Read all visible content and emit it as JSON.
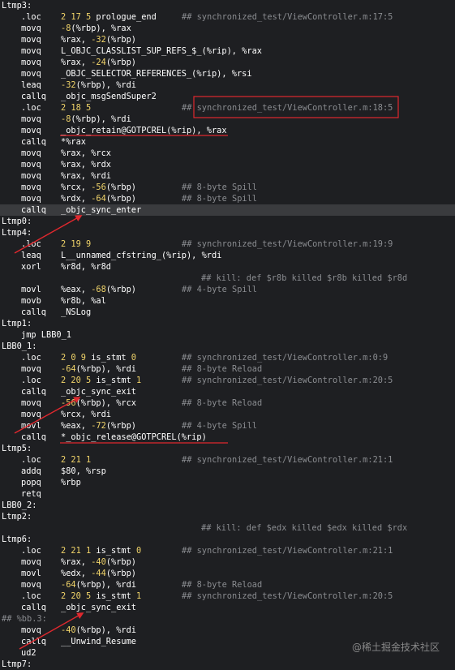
{
  "lines": [
    {
      "label": "Ltmp3:"
    },
    {
      "op": ".loc",
      "args": [
        {
          "t": "2 17 5",
          "n": true
        },
        {
          "t": " prologue_end"
        }
      ],
      "comment": "## synchronized_test/ViewController.m:17:5"
    },
    {
      "op": "movq",
      "args": [
        {
          "t": "-8",
          "n": true
        },
        {
          "t": "(%rbp), %rax"
        }
      ]
    },
    {
      "op": "movq",
      "args": [
        {
          "t": "%rax, "
        },
        {
          "t": "-32",
          "n": true
        },
        {
          "t": "(%rbp)"
        }
      ]
    },
    {
      "op": "movq",
      "args": [
        {
          "t": "L_OBJC_CLASSLIST_SUP_REFS_$_(%rip), %rax"
        }
      ]
    },
    {
      "op": "movq",
      "args": [
        {
          "t": "%rax, "
        },
        {
          "t": "-24",
          "n": true
        },
        {
          "t": "(%rbp)"
        }
      ]
    },
    {
      "op": "movq",
      "args": [
        {
          "t": "_OBJC_SELECTOR_REFERENCES_(%rip), %rsi"
        }
      ]
    },
    {
      "op": "leaq",
      "args": [
        {
          "t": "-32",
          "n": true
        },
        {
          "t": "(%rbp), %rdi"
        }
      ]
    },
    {
      "op": "callq",
      "args": [
        {
          "t": "_objc_msgSendSuper2"
        }
      ]
    },
    {
      "op": ".loc",
      "args": [
        {
          "t": "2 18 5",
          "n": true
        }
      ],
      "comment": "## synchronized_test/ViewController.m:18:5"
    },
    {
      "op": "movq",
      "args": [
        {
          "t": "-8",
          "n": true
        },
        {
          "t": "(%rbp), %rdi"
        }
      ]
    },
    {
      "op": "movq",
      "args": [
        {
          "t": "_objc_retain@GOTPCREL(%rip), %rax"
        }
      ]
    },
    {
      "op": "callq",
      "args": [
        {
          "t": "*%rax"
        }
      ]
    },
    {
      "op": "movq",
      "args": [
        {
          "t": "%rax, %rcx"
        }
      ]
    },
    {
      "op": "movq",
      "args": [
        {
          "t": "%rax, %rdx"
        }
      ]
    },
    {
      "op": "movq",
      "args": [
        {
          "t": "%rax, %rdi"
        }
      ]
    },
    {
      "op": "movq",
      "args": [
        {
          "t": "%rcx, "
        },
        {
          "t": "-56",
          "n": true
        },
        {
          "t": "(%rbp)"
        }
      ],
      "comment": "## 8-byte Spill"
    },
    {
      "op": "movq",
      "args": [
        {
          "t": "%rdx, "
        },
        {
          "t": "-64",
          "n": true
        },
        {
          "t": "(%rbp)"
        }
      ],
      "comment": "## 8-byte Spill"
    },
    {
      "op": "callq",
      "args": [
        {
          "t": "_objc_sync_enter"
        }
      ],
      "hl": true
    },
    {
      "label": "Ltmp0:"
    },
    {
      "label": "Ltmp4:"
    },
    {
      "op": ".loc",
      "args": [
        {
          "t": "2 19 9",
          "n": true
        }
      ],
      "comment": "## synchronized_test/ViewController.m:19:9"
    },
    {
      "op": "leaq",
      "args": [
        {
          "t": "L__unnamed_cfstring_(%rip), %rdi"
        }
      ]
    },
    {
      "op": "xorl",
      "args": [
        {
          "t": "%r8d, %r8d"
        }
      ]
    },
    {
      "comment2": "## kill: def $r8b killed $r8b killed $r8d"
    },
    {
      "op": "movl",
      "args": [
        {
          "t": "%eax, "
        },
        {
          "t": "-68",
          "n": true
        },
        {
          "t": "(%rbp)"
        }
      ],
      "comment": "## 4-byte Spill"
    },
    {
      "op": "movb",
      "args": [
        {
          "t": "%r8b, %al"
        }
      ]
    },
    {
      "op": "callq",
      "args": [
        {
          "t": "_NSLog"
        }
      ]
    },
    {
      "label": "Ltmp1:"
    },
    {
      "jmp": "jmp LBB0_1"
    },
    {
      "label": "LBB0_1:"
    },
    {
      "op": ".loc",
      "args": [
        {
          "t": "2 0 9",
          "n": true
        },
        {
          "t": " is_stmt "
        },
        {
          "t": "0",
          "n": true
        }
      ],
      "comment": "## synchronized_test/ViewController.m:0:9"
    },
    {
      "op": "movq",
      "args": [
        {
          "t": "-64",
          "n": true
        },
        {
          "t": "(%rbp), %rdi"
        }
      ],
      "comment": "## 8-byte Reload"
    },
    {
      "op": ".loc",
      "args": [
        {
          "t": "2 20 5",
          "n": true
        },
        {
          "t": " is_stmt "
        },
        {
          "t": "1",
          "n": true
        }
      ],
      "comment": "## synchronized_test/ViewController.m:20:5"
    },
    {
      "op": "callq",
      "args": [
        {
          "t": "_objc_sync_exit"
        }
      ]
    },
    {
      "op": "movq",
      "args": [
        {
          "t": "-56",
          "n": true
        },
        {
          "t": "(%rbp), %rcx"
        }
      ],
      "comment": "## 8-byte Reload"
    },
    {
      "op": "movq",
      "args": [
        {
          "t": "%rcx, %rdi"
        }
      ]
    },
    {
      "op": "movl",
      "args": [
        {
          "t": "%eax, "
        },
        {
          "t": "-72",
          "n": true
        },
        {
          "t": "(%rbp)"
        }
      ],
      "comment": "## 4-byte Spill"
    },
    {
      "op": "callq",
      "args": [
        {
          "t": "*_objc_release@GOTPCREL(%rip)"
        }
      ]
    },
    {
      "label": "Ltmp5:"
    },
    {
      "op": ".loc",
      "args": [
        {
          "t": "2 21 1",
          "n": true
        }
      ],
      "comment": "## synchronized_test/ViewController.m:21:1"
    },
    {
      "op": "addq",
      "args": [
        {
          "t": "$80, %rsp"
        }
      ]
    },
    {
      "op": "popq",
      "args": [
        {
          "t": "%rbp"
        }
      ]
    },
    {
      "op": "retq",
      "args": []
    },
    {
      "label": "LBB0_2:"
    },
    {
      "label": "Ltmp2:"
    },
    {
      "comment2": "## kill: def $edx killed $edx killed $rdx"
    },
    {
      "label": "Ltmp6:"
    },
    {
      "op": ".loc",
      "args": [
        {
          "t": "2 21 1",
          "n": true
        },
        {
          "t": " is_stmt "
        },
        {
          "t": "0",
          "n": true
        }
      ],
      "comment": "## synchronized_test/ViewController.m:21:1"
    },
    {
      "op": "movq",
      "args": [
        {
          "t": "%rax, "
        },
        {
          "t": "-40",
          "n": true
        },
        {
          "t": "(%rbp)"
        }
      ]
    },
    {
      "op": "movl",
      "args": [
        {
          "t": "%edx, "
        },
        {
          "t": "-44",
          "n": true
        },
        {
          "t": "(%rbp)"
        }
      ]
    },
    {
      "op": "movq",
      "args": [
        {
          "t": "-64",
          "n": true
        },
        {
          "t": "(%rbp), %rdi"
        }
      ],
      "comment": "## 8-byte Reload"
    },
    {
      "op": ".loc",
      "args": [
        {
          "t": "2 20 5",
          "n": true
        },
        {
          "t": " is_stmt "
        },
        {
          "t": "1",
          "n": true
        }
      ],
      "comment": "## synchronized_test/ViewController.m:20:5"
    },
    {
      "op": "callq",
      "args": [
        {
          "t": "_objc_sync_exit"
        }
      ]
    },
    {
      "dimlabel": "## %bb.3:"
    },
    {
      "op": "movq",
      "args": [
        {
          "t": "-40",
          "n": true
        },
        {
          "t": "(%rbp), %rdi"
        }
      ]
    },
    {
      "op": "callq",
      "args": [
        {
          "t": "__Unwind_Resume"
        }
      ]
    },
    {
      "op": "ud2",
      "args": []
    },
    {
      "label": "Ltmp7:"
    }
  ],
  "watermark": "@稀土掘金技术社区",
  "colors": {
    "background": "#1e1f22",
    "text": "#ffffff",
    "number": "#f2d56a",
    "comment": "#8a8c90",
    "highlight_row": "#3a3b3e",
    "annotation": "#e0282e"
  }
}
